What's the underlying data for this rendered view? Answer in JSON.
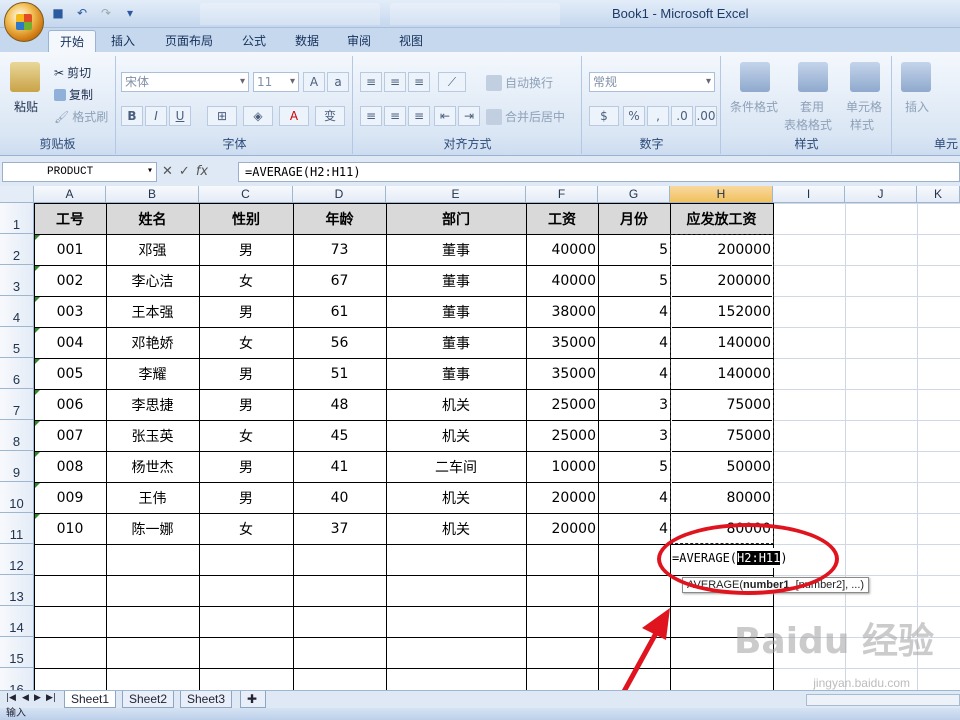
{
  "window": {
    "title": "Book1 - Microsoft Excel"
  },
  "ribbon_tabs": [
    "开始",
    "插入",
    "页面布局",
    "公式",
    "数据",
    "审阅",
    "视图"
  ],
  "ribbon": {
    "clipboard": {
      "label": "剪贴板",
      "paste": "粘贴",
      "cut": "剪切",
      "copy": "复制",
      "format_painter": "格式刷"
    },
    "font": {
      "label": "字体",
      "font_name": "宋体",
      "font_size": "11",
      "bold": "B",
      "italic": "I",
      "underline": "U"
    },
    "alignment": {
      "label": "对齐方式",
      "wrap_text": "自动换行",
      "merge_center": "合并后居中"
    },
    "number": {
      "label": "数字",
      "format": "常规"
    },
    "styles": {
      "label": "样式",
      "conditional": "条件格式",
      "table_format_1": "套用",
      "table_format_2": "表格格式",
      "cell_styles_1": "单元格",
      "cell_styles_2": "样式"
    },
    "cells": {
      "label": "单元",
      "insert": "插入"
    }
  },
  "formula_bar": {
    "name_box": "PRODUCT",
    "formula": "=AVERAGE(H2:H11)"
  },
  "columns": [
    "A",
    "B",
    "C",
    "D",
    "E",
    "F",
    "G",
    "H",
    "I",
    "J",
    "K"
  ],
  "rows": [
    "1",
    "2",
    "3",
    "4",
    "5",
    "6",
    "7",
    "8",
    "9",
    "10",
    "11",
    "12",
    "13",
    "14",
    "15",
    "16"
  ],
  "headers": [
    "工号",
    "姓名",
    "性别",
    "年龄",
    "部门",
    "工资",
    "月份",
    "应发放工资"
  ],
  "table": [
    [
      "001",
      "邓强",
      "男",
      "73",
      "董事",
      "40000",
      "5",
      "200000"
    ],
    [
      "002",
      "李心洁",
      "女",
      "67",
      "董事",
      "40000",
      "5",
      "200000"
    ],
    [
      "003",
      "王本强",
      "男",
      "61",
      "董事",
      "38000",
      "4",
      "152000"
    ],
    [
      "004",
      "邓艳娇",
      "女",
      "56",
      "董事",
      "35000",
      "4",
      "140000"
    ],
    [
      "005",
      "李耀",
      "男",
      "51",
      "董事",
      "35000",
      "4",
      "140000"
    ],
    [
      "006",
      "李思捷",
      "男",
      "48",
      "机关",
      "25000",
      "3",
      "75000"
    ],
    [
      "007",
      "张玉英",
      "女",
      "45",
      "机关",
      "25000",
      "3",
      "75000"
    ],
    [
      "008",
      "杨世杰",
      "男",
      "41",
      "二车间",
      "10000",
      "5",
      "50000"
    ],
    [
      "009",
      "王伟",
      "男",
      "40",
      "机关",
      "20000",
      "4",
      "80000"
    ],
    [
      "010",
      "陈一娜",
      "女",
      "37",
      "机关",
      "20000",
      "4",
      "80000"
    ]
  ],
  "edit_cell": {
    "prefix": "=AVERAGE(",
    "ref": "H2:H11",
    "suffix": ")"
  },
  "tooltip": {
    "prefix": "AVERAGE(",
    "bold": "number1",
    "rest": ", [number2], ...)"
  },
  "sheets": [
    "Sheet1",
    "Sheet2",
    "Sheet3"
  ],
  "status": "输入",
  "watermark": {
    "logo": "Baidu 经验",
    "url": "jingyan.baidu.com"
  },
  "colors": {
    "highlight_ellipse": "#e0141e",
    "header_fill": "#d9d9d9",
    "selected_col": "#f1c15f"
  }
}
